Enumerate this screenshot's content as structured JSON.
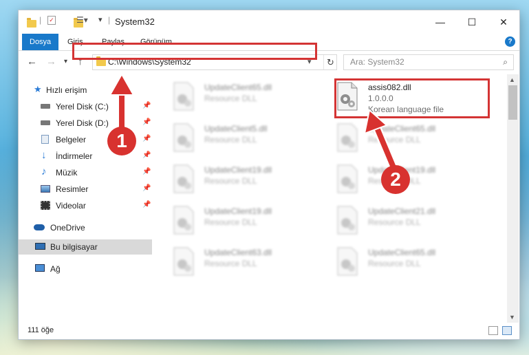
{
  "window": {
    "title": "System32",
    "controls": {
      "minimize": "—",
      "maximize": "☐",
      "close": "✕"
    }
  },
  "ribbon": {
    "tabs": [
      "Dosya",
      "Giriş",
      "Paylaş",
      "Görünüm"
    ],
    "help": "?"
  },
  "address": {
    "path": "C:\\Windows\\System32"
  },
  "search": {
    "placeholder": "Ara: System32"
  },
  "sidebar": {
    "items": [
      {
        "label": "Hızlı erişim",
        "icon": "star-icon"
      },
      {
        "label": "Yerel Disk (C:)",
        "icon": "drive-icon"
      },
      {
        "label": "Yerel Disk (D:)",
        "icon": "drive-icon"
      },
      {
        "label": "Belgeler",
        "icon": "documents-icon"
      },
      {
        "label": "İndirmeler",
        "icon": "download-icon"
      },
      {
        "label": "Müzik",
        "icon": "music-icon"
      },
      {
        "label": "Resimler",
        "icon": "pictures-icon"
      },
      {
        "label": "Videolar",
        "icon": "video-icon"
      },
      {
        "label": "OneDrive",
        "icon": "cloud-icon"
      },
      {
        "label": "Bu bilgisayar",
        "icon": "computer-icon"
      },
      {
        "label": "Ağ",
        "icon": "network-icon"
      }
    ]
  },
  "files": [
    {
      "name": "UpdateClient65.dll",
      "type": "Resource DLL"
    },
    {
      "name": "assis082.dll",
      "version": "1.0.0.0",
      "type": "Korean language file"
    },
    {
      "name": "UpdateClient5.dll",
      "type": "Resource DLL"
    },
    {
      "name": "UpdateClient65.dll",
      "type": "Resource DLL"
    },
    {
      "name": "UpdateClient19.dll",
      "type": "Resource DLL"
    },
    {
      "name": "UpdateClient19.dll",
      "type": "Resource DLL"
    },
    {
      "name": "UpdateClient19.dll",
      "type": "Resource DLL"
    },
    {
      "name": "UpdateClient21.dll",
      "type": "Resource DLL"
    },
    {
      "name": "UpdateClient63.dll",
      "type": "Resource DLL"
    },
    {
      "name": "UpdateClient65.dll",
      "type": "Resource DLL"
    }
  ],
  "status": {
    "count": "111 öğe"
  },
  "callouts": [
    "1",
    "2"
  ],
  "colors": {
    "accent": "#1979ca",
    "highlight": "#d43434",
    "callout": "#d8322f"
  }
}
